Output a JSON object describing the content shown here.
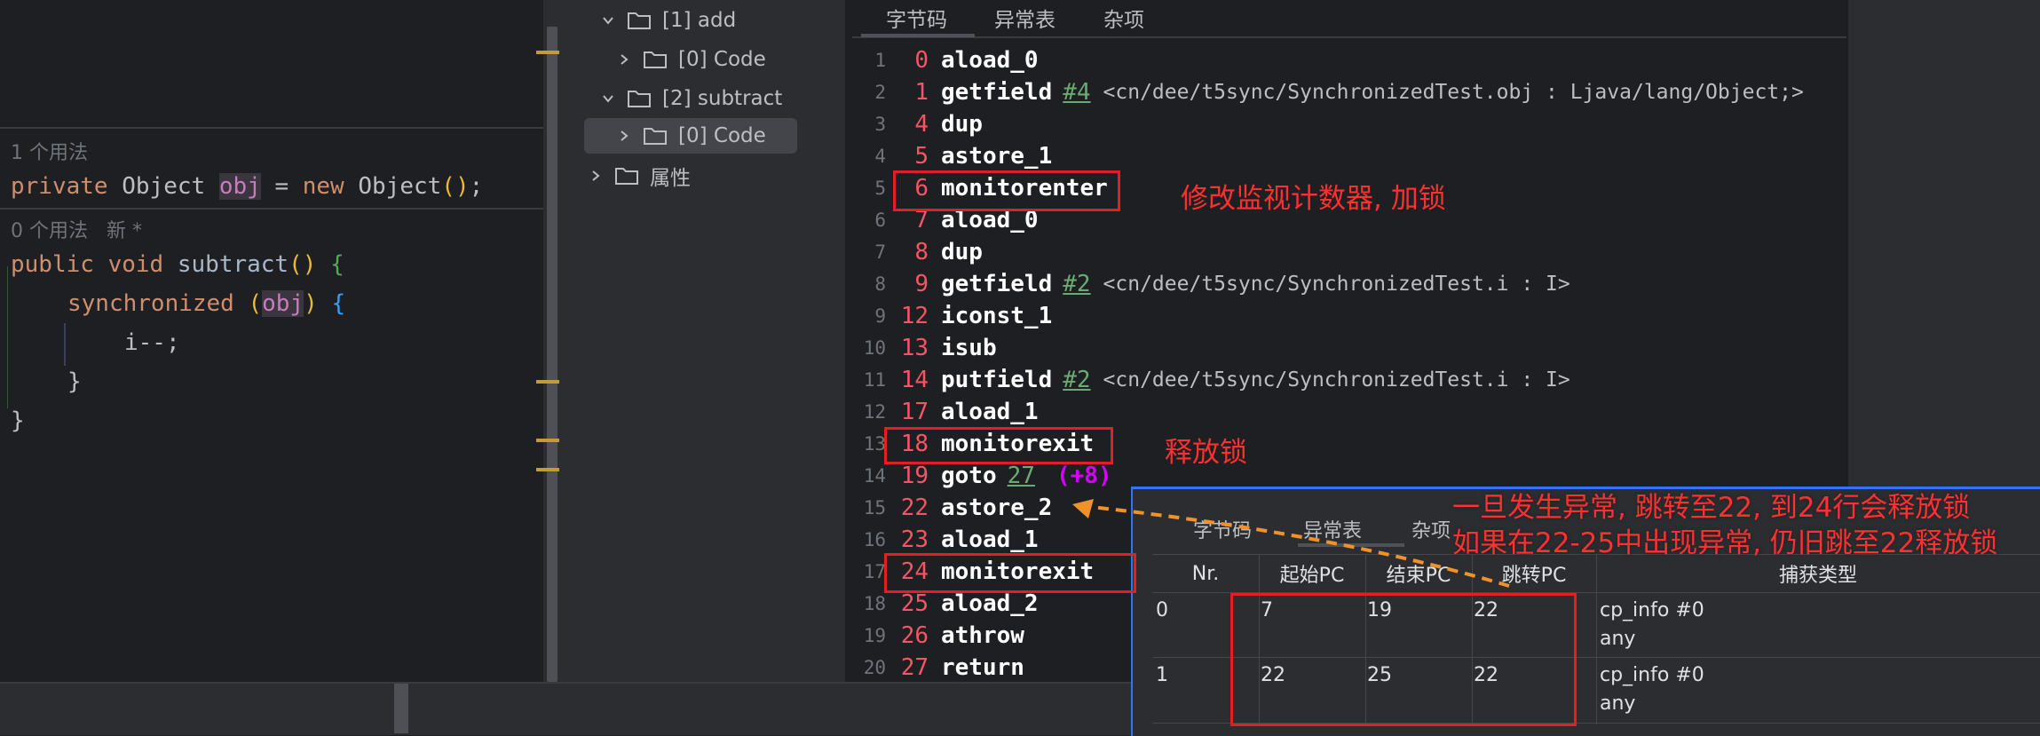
{
  "editor": {
    "usage_hint_1": "1 个用法",
    "field_line": {
      "kw1": "private",
      "type": "Object",
      "name": "obj",
      "eq": "=",
      "kw2": "new",
      "ctor": "Object",
      "parens": "()",
      "semi": ";"
    },
    "usage_hint_2": "0 个用法",
    "new_hint": "新 *",
    "method_line": {
      "kw1": "public",
      "kw2": "void",
      "name": "subtract",
      "parens": "()",
      "brace": "{"
    },
    "sync_line": {
      "kw": "synchronized",
      "open": "(",
      "arg": "obj",
      "close": ")",
      "brace": "{"
    },
    "body_line": "i--;",
    "close_inner": "}",
    "close_outer": "}"
  },
  "tree": {
    "items": [
      {
        "label": "[1] add"
      },
      {
        "label": "[0] Code"
      },
      {
        "label": "[2] subtract"
      },
      {
        "label": "[0] Code"
      },
      {
        "label": "属性"
      }
    ]
  },
  "bytecode": {
    "tabs": [
      "字节码",
      "异常表",
      "杂项"
    ],
    "rows": [
      {
        "ln": "1",
        "off": "0",
        "op": "aload_0",
        "ref": "",
        "arg": "",
        "extra": ""
      },
      {
        "ln": "2",
        "off": "1",
        "op": "getfield",
        "ref": "#4",
        "arg": "<cn/dee/t5sync/SynchronizedTest.obj : Ljava/lang/Object;>",
        "extra": ""
      },
      {
        "ln": "3",
        "off": "4",
        "op": "dup",
        "ref": "",
        "arg": "",
        "extra": ""
      },
      {
        "ln": "4",
        "off": "5",
        "op": "astore_1",
        "ref": "",
        "arg": "",
        "extra": ""
      },
      {
        "ln": "5",
        "off": "6",
        "op": "monitorenter",
        "ref": "",
        "arg": "",
        "extra": ""
      },
      {
        "ln": "6",
        "off": "7",
        "op": "aload_0",
        "ref": "",
        "arg": "",
        "extra": ""
      },
      {
        "ln": "7",
        "off": "8",
        "op": "dup",
        "ref": "",
        "arg": "",
        "extra": ""
      },
      {
        "ln": "8",
        "off": "9",
        "op": "getfield",
        "ref": "#2",
        "arg": "<cn/dee/t5sync/SynchronizedTest.i : I>",
        "extra": ""
      },
      {
        "ln": "9",
        "off": "12",
        "op": "iconst_1",
        "ref": "",
        "arg": "",
        "extra": ""
      },
      {
        "ln": "10",
        "off": "13",
        "op": "isub",
        "ref": "",
        "arg": "",
        "extra": ""
      },
      {
        "ln": "11",
        "off": "14",
        "op": "putfield",
        "ref": "#2",
        "arg": "<cn/dee/t5sync/SynchronizedTest.i : I>",
        "extra": ""
      },
      {
        "ln": "12",
        "off": "17",
        "op": "aload_1",
        "ref": "",
        "arg": "",
        "extra": ""
      },
      {
        "ln": "13",
        "off": "18",
        "op": "monitorexit",
        "ref": "",
        "arg": "",
        "extra": ""
      },
      {
        "ln": "14",
        "off": "19",
        "op": "goto",
        "ref": "27",
        "arg": "",
        "extra": "(+8)"
      },
      {
        "ln": "15",
        "off": "22",
        "op": "astore_2",
        "ref": "",
        "arg": "",
        "extra": ""
      },
      {
        "ln": "16",
        "off": "23",
        "op": "aload_1",
        "ref": "",
        "arg": "",
        "extra": ""
      },
      {
        "ln": "17",
        "off": "24",
        "op": "monitorexit",
        "ref": "",
        "arg": "",
        "extra": ""
      },
      {
        "ln": "18",
        "off": "25",
        "op": "aload_2",
        "ref": "",
        "arg": "",
        "extra": ""
      },
      {
        "ln": "19",
        "off": "26",
        "op": "athrow",
        "ref": "",
        "arg": "",
        "extra": ""
      },
      {
        "ln": "20",
        "off": "27",
        "op": "return",
        "ref": "",
        "arg": "",
        "extra": ""
      }
    ]
  },
  "popup": {
    "tabs": [
      "字节码",
      "异常表",
      "杂项"
    ],
    "headers": [
      "Nr.",
      "起始PC",
      "结束PC",
      "跳转PC",
      "捕获类型"
    ],
    "rows": [
      {
        "nr": "0",
        "start": "7",
        "end": "19",
        "handler": "22",
        "type": "cp_info #0\nany"
      },
      {
        "nr": "1",
        "start": "22",
        "end": "25",
        "handler": "22",
        "type": "cp_info #0\nany"
      }
    ]
  },
  "annotations": {
    "lock": "修改监视计数器, 加锁",
    "release": "释放锁",
    "exception_1": "一旦发生异常, 跳转至22, 到24行会释放锁",
    "exception_2": "如果在22-25中出现异常, 仍旧跳至22释放锁",
    "color": "#e31e24"
  }
}
